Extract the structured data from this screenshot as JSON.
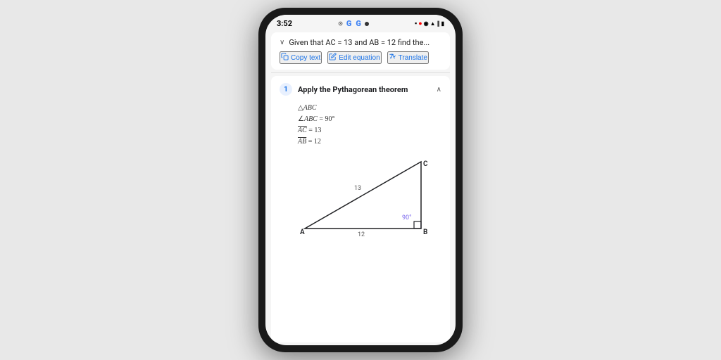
{
  "phone": {
    "status_bar": {
      "time": "3:52",
      "center_icons": "● G G ●",
      "right_icons": "▪ 🔴 ◉ ▲ ∥ ⬛"
    },
    "search": {
      "query": "Given that AC = 13 and AB = 12 find the...",
      "chevron": "∨"
    },
    "action_buttons": [
      {
        "icon": "📋",
        "label": "Copy text"
      },
      {
        "icon": "✏️",
        "label": "Edit equation"
      },
      {
        "icon": "🌐",
        "label": "Translate"
      }
    ],
    "step": {
      "number": "1",
      "title": "Apply the Pythagorean theorem",
      "collapse_icon": "∧"
    },
    "math": {
      "triangle": "△ABC",
      "angle_line": "∠ABC = 90°",
      "ac_line": "AC = 13",
      "ab_line": "AB = 12"
    },
    "triangle_labels": {
      "A": "A",
      "B": "B",
      "C": "C",
      "side_ac": "13",
      "side_ab": "12",
      "angle": "90°"
    },
    "colors": {
      "blue": "#1a73e8",
      "purple": "#7b68ee",
      "text_dark": "#202124"
    }
  }
}
